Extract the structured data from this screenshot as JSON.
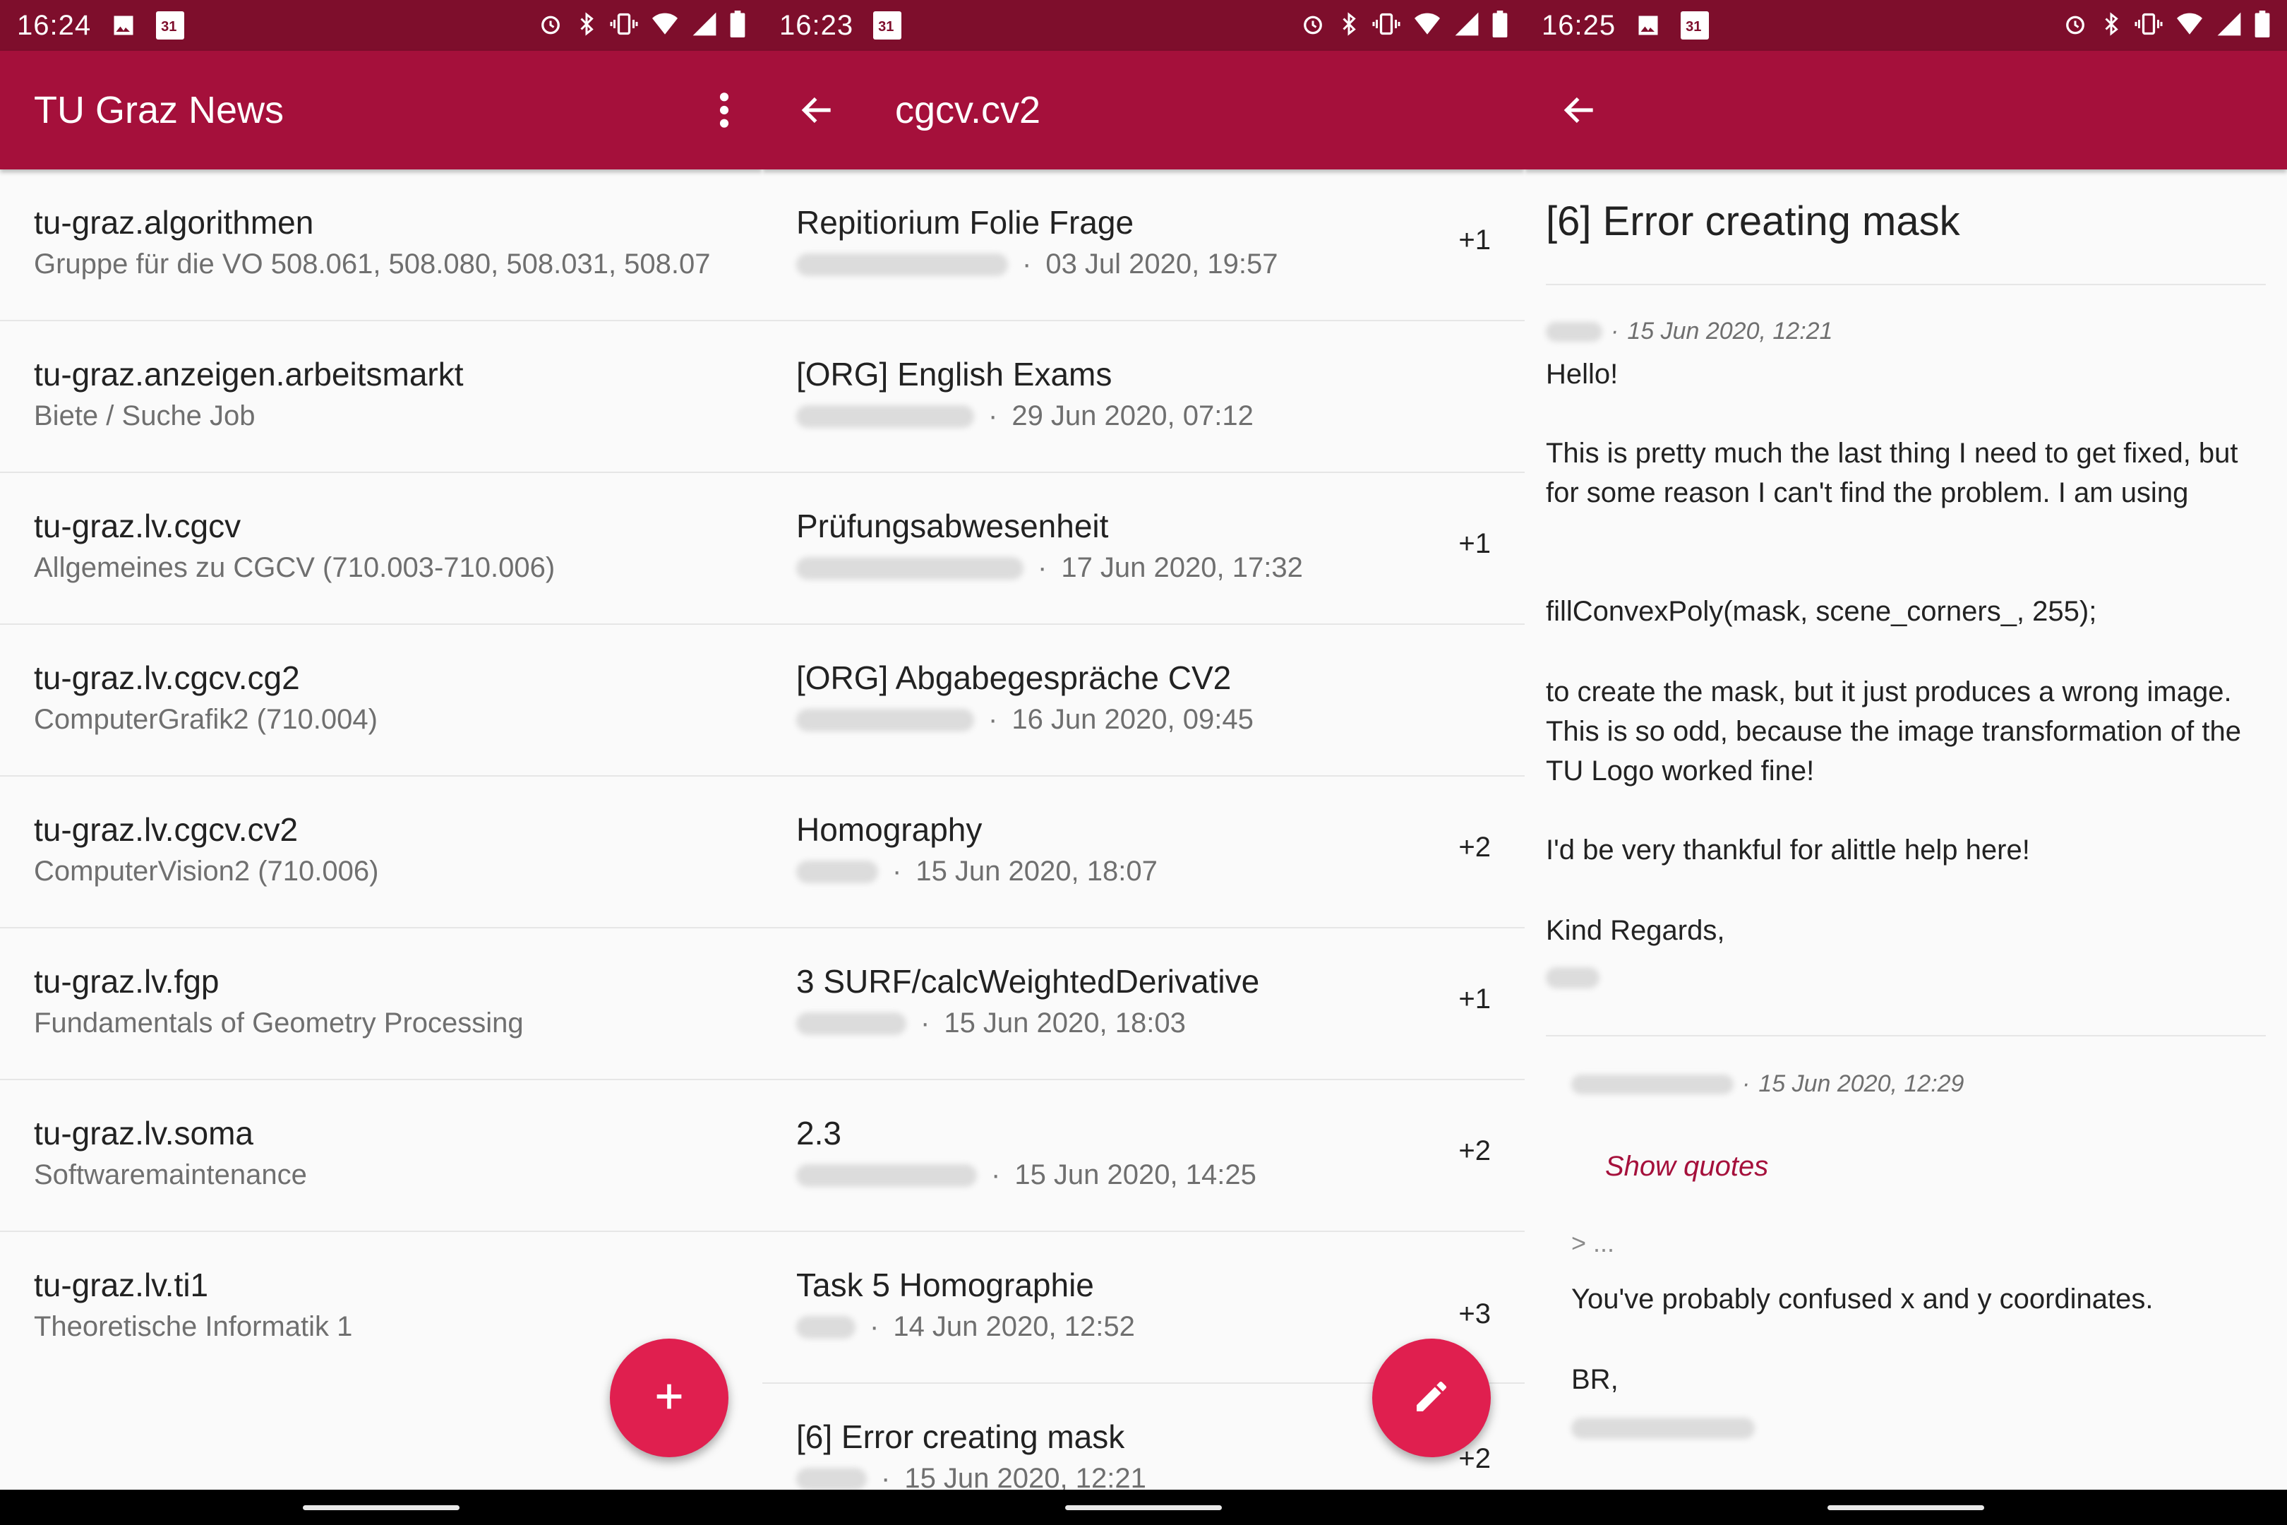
{
  "screen1": {
    "status": {
      "time": "16:24",
      "calendar_day": "31"
    },
    "appbar": {
      "title": "TU Graz News"
    },
    "groups": [
      {
        "name": "tu-graz.algorithmen",
        "desc": "Gruppe für die VO 508.061, 508.080, 508.031, 508.07"
      },
      {
        "name": "tu-graz.anzeigen.arbeitsmarkt",
        "desc": "Biete / Suche Job"
      },
      {
        "name": "tu-graz.lv.cgcv",
        "desc": "Allgemeines zu CGCV (710.003-710.006)"
      },
      {
        "name": "tu-graz.lv.cgcv.cg2",
        "desc": "ComputerGrafik2 (710.004)"
      },
      {
        "name": "tu-graz.lv.cgcv.cv2",
        "desc": "ComputerVision2 (710.006)"
      },
      {
        "name": "tu-graz.lv.fgp",
        "desc": "Fundamentals of Geometry Processing"
      },
      {
        "name": "tu-graz.lv.soma",
        "desc": "Softwaremaintenance"
      },
      {
        "name": "tu-graz.lv.ti1",
        "desc": "Theoretische Informatik 1"
      }
    ]
  },
  "screen2": {
    "status": {
      "time": "16:23",
      "calendar_day": "31"
    },
    "appbar": {
      "title": "cgcv.cv2"
    },
    "threads": [
      {
        "subject": "Repitiorium Folie Frage",
        "date": "03 Jul 2020, 19:57",
        "count": "+1"
      },
      {
        "subject": "[ORG] English Exams",
        "date": "29 Jun 2020, 07:12",
        "count": ""
      },
      {
        "subject": "Prüfungsabwesenheit",
        "date": "17 Jun 2020, 17:32",
        "count": "+1"
      },
      {
        "subject": "[ORG] Abgabegespräche CV2",
        "date": "16 Jun 2020, 09:45",
        "count": ""
      },
      {
        "subject": "Homography",
        "date": "15 Jun 2020, 18:07",
        "count": "+2"
      },
      {
        "subject": "3 SURF/calcWeightedDerivative",
        "date": "15 Jun 2020, 18:03",
        "count": "+1"
      },
      {
        "subject": "2.3",
        "date": "15 Jun 2020, 14:25",
        "count": "+2"
      },
      {
        "subject": "Task 5 Homographie",
        "date": "14 Jun 2020, 12:52",
        "count": "+3"
      },
      {
        "subject": "[6] Error creating mask",
        "date": "15 Jun 2020, 12:21",
        "count": "+2"
      }
    ]
  },
  "screen3": {
    "status": {
      "time": "16:25",
      "calendar_day": "31"
    },
    "thread_title": "[6] Error creating mask",
    "msg1": {
      "date": "15 Jun 2020, 12:21",
      "p1": "Hello!",
      "p2": "This is pretty much the last thing I need to get fixed, but for some reason I can't find the problem. I am using",
      "p3": "fillConvexPoly(mask, scene_corners_, 255);",
      "p4": "to create the mask, but it just produces a wrong image. This is so odd, because the image transformation of the TU Logo worked fine!",
      "p5": "I'd be very thankful for alittle help here!",
      "p6": "Kind Regards,"
    },
    "msg2": {
      "date": "15 Jun 2020, 12:29",
      "show_quotes": "Show quotes",
      "quote": "> ...",
      "p1": "You've probably confused x and y coordinates.",
      "p2": "BR,"
    }
  },
  "colors": {
    "statusbar": "#7e0e2c",
    "appbar": "#a5103b",
    "fab": "#e01f4f"
  }
}
